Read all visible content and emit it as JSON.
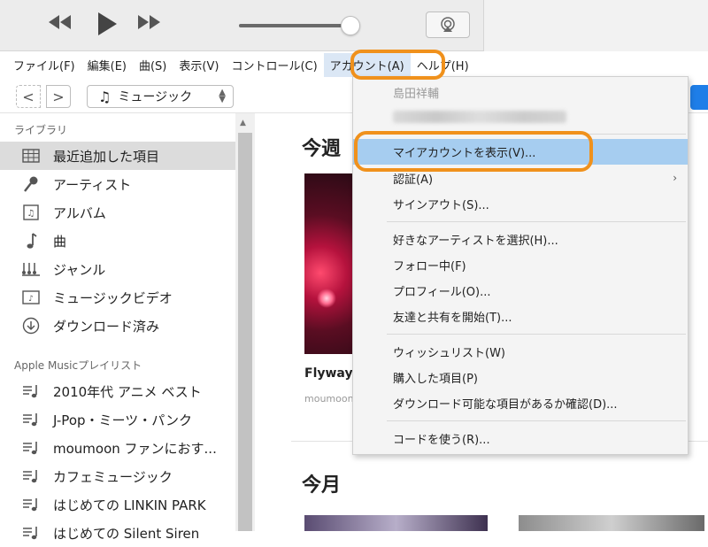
{
  "menubar": {
    "items": [
      "ファイル(F)",
      "編集(E)",
      "曲(S)",
      "表示(V)",
      "コントロール(C)",
      "アカウント(A)",
      "ヘルプ(H)"
    ]
  },
  "player": {
    "volume_level": 0.92
  },
  "navigation": {
    "back": "<",
    "forward": ">",
    "media_type": "ミュージック"
  },
  "sidebar": {
    "library_header": "ライブラリ",
    "library_items": [
      "最近追加した項目",
      "アーティスト",
      "アルバム",
      "曲",
      "ジャンル",
      "ミュージックビデオ",
      "ダウンロード済み"
    ],
    "playlist_header": "Apple Musicプレイリスト",
    "playlists": [
      "2010年代 アニメ ベスト",
      "J-Pop・ミーツ・パンク",
      "moumoon ファンにおす...",
      "カフェミュージック",
      "はじめての LINKIN PARK",
      "はじめての Silent Siren"
    ]
  },
  "main": {
    "section_week": "今週",
    "album_title": "Flyway",
    "album_artist": "moumoon",
    "section_month": "今月"
  },
  "account_menu": {
    "user_name": "島田祥輔",
    "items": [
      "マイアカウントを表示(V)...",
      "認証(A)",
      "サインアウト(S)...",
      "好きなアーティストを選択(H)...",
      "フォロー中(F)",
      "プロフィール(O)...",
      "友達と共有を開始(T)...",
      "ウィッシュリスト(W)",
      "購入した項目(P)",
      "ダウンロード可能な項目があるか確認(D)...",
      "コードを使う(R)..."
    ],
    "submenu_arrow": "›",
    "highlight_color": "#f0911c",
    "hover_color": "#a6cdf0"
  }
}
